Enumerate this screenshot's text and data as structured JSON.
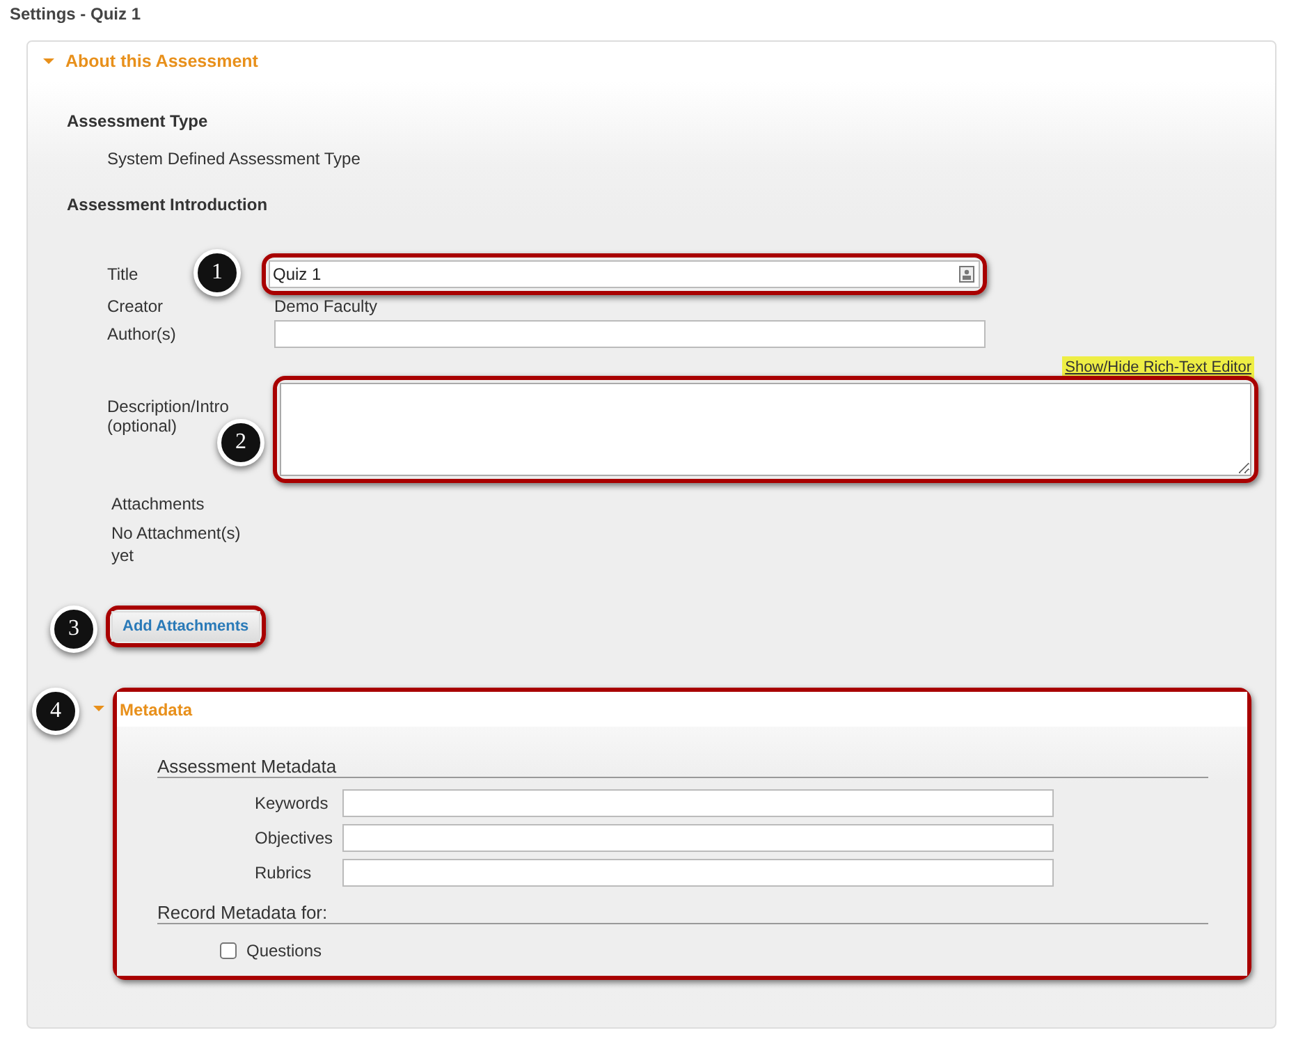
{
  "page_title": "Settings - Quiz 1",
  "about_section": {
    "title": "About this Assessment",
    "expanded": true,
    "assessment_type": {
      "heading": "Assessment Type",
      "value": "System Defined Assessment Type"
    },
    "introduction": {
      "heading": "Assessment Introduction",
      "title_field": {
        "label": "Title",
        "value": "Quiz 1",
        "callout": "1"
      },
      "creator": {
        "label": "Creator",
        "value": "Demo Faculty"
      },
      "authors_field": {
        "label": "Author(s)"
      },
      "rich_text_toggle": "Show/Hide Rich-Text Editor",
      "description_field": {
        "label": "Description/Intro (optional)",
        "callout": "2"
      },
      "attachments": {
        "label": "Attachments",
        "status": "No Attachment(s) yet"
      },
      "add_attachments_button": {
        "label": "Add Attachments",
        "callout": "3"
      }
    }
  },
  "metadata_section": {
    "title": "Metadata",
    "expanded": true,
    "callout": "4",
    "heading": "Assessment Metadata",
    "fields": [
      {
        "label": "Keywords"
      },
      {
        "label": "Objectives"
      },
      {
        "label": "Rubrics"
      }
    ],
    "record_heading": "Record Metadata for:",
    "options": [
      {
        "label": "Questions",
        "checked": false
      }
    ]
  }
}
